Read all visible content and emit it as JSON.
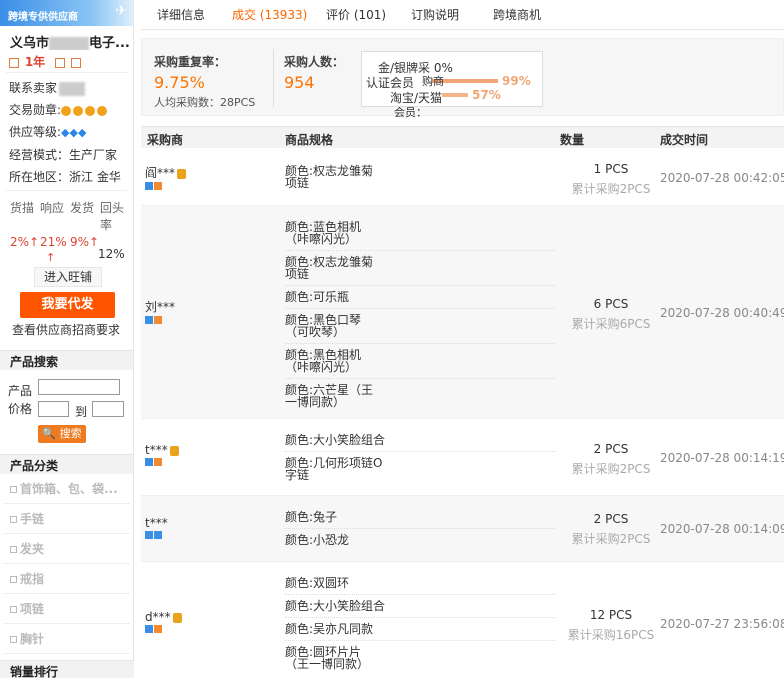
{
  "sidebar": {
    "banner": "跨境专供供应商",
    "shop_name": "义乌市",
    "shop_name_tail": "电子...",
    "years": "1年",
    "contact_label": "联系卖家",
    "trade_medal_label": "交易勋章:",
    "supply_level_label": "供应等级:",
    "business_model": "经营模式：生产厂家",
    "region": "所在地区：浙江 金华",
    "stats_labels": [
      "货描",
      "响应",
      "发货",
      "回头率"
    ],
    "stats_values": [
      "2%↑",
      "21%",
      "9%↑"
    ],
    "repeat_rate": "12%",
    "arrow_up": "↑",
    "wangwang_label": "进入旺铺",
    "dropship_button": "我要代发",
    "view_requirements": "查看供应商招商要求",
    "product_search_title": "产品搜索",
    "search_product_label": "产品",
    "search_price_label": "价格",
    "search_to_label": "到",
    "search_button": "搜索",
    "category_title": "产品分类",
    "categories": [
      "首饰箱、包、袋...",
      "手链",
      "发夹",
      "戒指",
      "项链",
      "胸针"
    ],
    "sales_rank_title": "销量排行"
  },
  "tabs": [
    {
      "label": "详细信息"
    },
    {
      "label": "成交 (13933)"
    },
    {
      "label": "评价 (101)"
    },
    {
      "label": "订购说明"
    },
    {
      "label": "跨境商机"
    }
  ],
  "summary": {
    "repeat_rate_title": "采购重复率：",
    "repeat_rate_value": "9.75%",
    "avg_purchase": "人均采购数：28PCS",
    "buyers_title": "采购人数：",
    "buyers_value": "954",
    "tooltip_rows": [
      "金/银牌采 0%",
      "认证会员",
      "99%",
      "淘宝/天猫",
      "57%",
      "会员：",
      "购商"
    ]
  },
  "table": {
    "headers": [
      "采购商",
      "商品规格",
      "数量",
      "成交时间"
    ],
    "rows": [
      {
        "buyer": "阎***",
        "specs": [
          "颜色:权志龙雏菊项链"
        ],
        "qty": "1 PCS",
        "total": "累计采购2PCS",
        "time": "2020-07-28 00:42:05"
      },
      {
        "buyer": "刘***",
        "specs": [
          "颜色:蓝色相机（咔嚓闪光）",
          "颜色:权志龙雏菊项链",
          "颜色:可乐瓶",
          "颜色:黑色口琴（可吹琴）",
          "颜色:黑色相机（咔嚓闪光）",
          "颜色:六芒星（王一博同款）"
        ],
        "qty": "6 PCS",
        "total": "累计采购6PCS",
        "time": "2020-07-28 00:40:49"
      },
      {
        "buyer": "t***",
        "specs": [
          "颜色:大小笑脸组合",
          "颜色:几何形项链O字链"
        ],
        "qty": "2 PCS",
        "total": "累计采购2PCS",
        "time": "2020-07-28 00:14:19"
      },
      {
        "buyer": "t***",
        "specs": [
          "颜色:兔子",
          "颜色:小恐龙"
        ],
        "qty": "2 PCS",
        "total": "累计采购2PCS",
        "time": "2020-07-28 00:14:09"
      },
      {
        "buyer": "d***",
        "specs": [
          "颜色:双圆环",
          "颜色:大小笑脸组合",
          "颜色:吴亦凡同款",
          "颜色:圆环片片（王一博同款）"
        ],
        "qty": "12 PCS",
        "total": "累计采购16PCS",
        "time": "2020-07-27 23:56:08"
      }
    ]
  }
}
